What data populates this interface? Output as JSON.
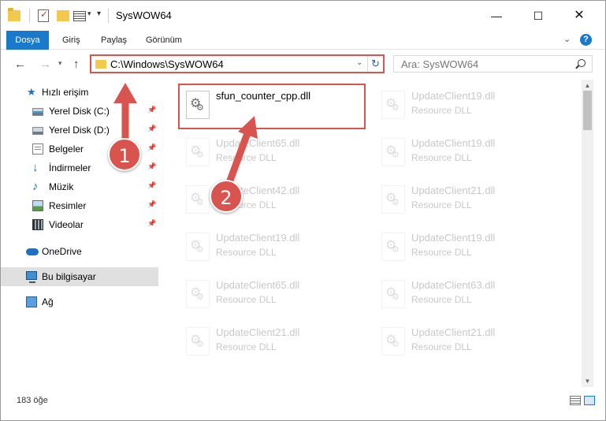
{
  "window": {
    "title": "SysWOW64",
    "controls": {
      "minimize": "—",
      "maximize": "☐",
      "close": "✕"
    }
  },
  "ribbon": {
    "file_tab": "Dosya",
    "tabs": [
      "Giriş",
      "Paylaş",
      "Görünüm"
    ],
    "help": "?"
  },
  "nav": {
    "address": "C:\\Windows\\SysWOW64",
    "search_placeholder": "Ara: SysWOW64"
  },
  "sidebar": {
    "items": [
      {
        "label": "Hızlı erişim",
        "icon": "star-icon"
      },
      {
        "label": "Yerel Disk (C:)",
        "icon": "drive-icon",
        "pinned": true
      },
      {
        "label": "Yerel Disk (D:)",
        "icon": "drive-icon",
        "pinned": true
      },
      {
        "label": "Belgeler",
        "icon": "document-icon",
        "pinned": true
      },
      {
        "label": "İndirmeler",
        "icon": "download-icon",
        "pinned": true
      },
      {
        "label": "Müzik",
        "icon": "music-icon",
        "pinned": true
      },
      {
        "label": "Resimler",
        "icon": "picture-icon",
        "pinned": true
      },
      {
        "label": "Videolar",
        "icon": "video-icon",
        "pinned": true
      },
      {
        "label": "OneDrive",
        "icon": "cloud-icon"
      },
      {
        "label": "Bu bilgisayar",
        "icon": "computer-icon",
        "selected": true
      },
      {
        "label": "Ağ",
        "icon": "network-icon"
      }
    ]
  },
  "files": {
    "highlighted": {
      "name": "sfun_counter_cpp.dll",
      "desc": ""
    },
    "left": [
      {
        "name": "UpdateClient65.dll",
        "desc": "Resource DLL"
      },
      {
        "name": "UpdateClient42.dll",
        "desc": "Resource DLL"
      },
      {
        "name": "UpdateClient19.dll",
        "desc": "Resource DLL"
      },
      {
        "name": "UpdateClient65.dll",
        "desc": "Resource DLL"
      },
      {
        "name": "UpdateClient21.dll",
        "desc": "Resource DLL"
      }
    ],
    "right": [
      {
        "name": "UpdateClient19.dll",
        "desc": "Resource DLL"
      },
      {
        "name": "UpdateClient19.dll",
        "desc": "Resource DLL"
      },
      {
        "name": "UpdateClient21.dll",
        "desc": "Resource DLL"
      },
      {
        "name": "UpdateClient19.dll",
        "desc": "Resource DLL"
      },
      {
        "name": "UpdateClient63.dll",
        "desc": "Resource DLL"
      },
      {
        "name": "UpdateClient21.dll",
        "desc": "Resource DLL"
      }
    ]
  },
  "status": {
    "count": "183 öğe"
  },
  "annotations": {
    "step1": "1",
    "step2": "2"
  },
  "colors": {
    "accent": "#1979ca",
    "annotation": "#d9534f"
  }
}
